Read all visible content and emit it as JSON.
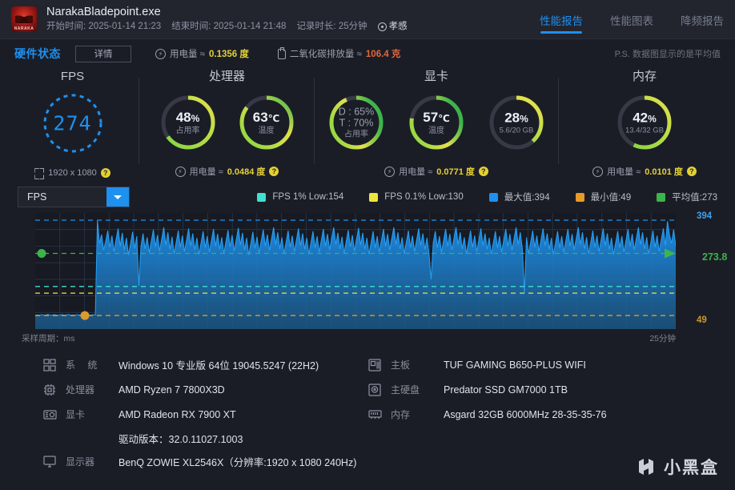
{
  "header": {
    "app_icon_label": "NARAKA",
    "title": "NarakaBladepoint.exe",
    "start_label": "开始时间:",
    "start_time": "2025-01-14 21:23",
    "end_label": "结束时间:",
    "end_time": "2025-01-14 21:48",
    "duration_label": "记录时长:",
    "duration": "25分钟",
    "location": "孝感",
    "tabs": [
      {
        "label": "性能报告",
        "active": true
      },
      {
        "label": "性能图表",
        "active": false
      },
      {
        "label": "降频报告",
        "active": false
      }
    ]
  },
  "statusbar": {
    "section_title": "硬件状态",
    "detail_button": "详情",
    "power_label": "用电量 ≈",
    "power_value": "0.1356 度",
    "co2_label": "二氧化碳排放量 ≈",
    "co2_value": "106.4 克",
    "note": "P.S. 数据图显示的是平均值"
  },
  "gauges": {
    "fps": {
      "title": "FPS",
      "value": "274",
      "resolution": "1920 x 1080",
      "help": "?"
    },
    "cpu": {
      "title": "处理器",
      "items": [
        {
          "main": "48",
          "unit": "%",
          "sub": "占用率",
          "pct": 48
        },
        {
          "main": "63",
          "unit": "℃",
          "sub": "温度",
          "pct": 63
        }
      ],
      "power_label": "用电量 ≈",
      "power_value": "0.0484 度",
      "help": "?"
    },
    "gpu": {
      "title": "显卡",
      "items": [
        {
          "main": "D : 65%",
          "line2": "T : 70%",
          "sub": "占用率",
          "pct": 70,
          "dim": true
        },
        {
          "main": "57",
          "unit": "℃",
          "sub": "温度",
          "pct": 57
        },
        {
          "main": "28",
          "unit": "%",
          "sub": "5.6/20 GB",
          "pct": 28
        }
      ],
      "power_label": "用电量 ≈",
      "power_value": "0.0771 度",
      "help": "?"
    },
    "mem": {
      "title": "内存",
      "items": [
        {
          "main": "42",
          "unit": "%",
          "sub": "13.4/32 GB",
          "pct": 42
        }
      ],
      "power_label": "用电量 ≈",
      "power_value": "0.0101 度",
      "help": "?"
    }
  },
  "chart_toolbar": {
    "metric_selected": "FPS",
    "legend": [
      {
        "label": "FPS 1% Low:154",
        "color": "#3fe0d0"
      },
      {
        "label": "FPS 0.1% Low:130",
        "color": "#efe63c"
      },
      {
        "label": "最大值:394",
        "color": "#1e90ee"
      },
      {
        "label": "最小值:49",
        "color": "#e79b28"
      },
      {
        "label": "平均值:273",
        "color": "#3cb44a"
      }
    ]
  },
  "chart_data": {
    "type": "area",
    "title": "FPS",
    "xlabel": "采样周期：ms",
    "ylabel": "",
    "x_end_label": "25分钟",
    "ylim": [
      0,
      420
    ],
    "grid": true,
    "legend_position": "top-right",
    "reference_lines": [
      {
        "name": "最大值",
        "value": 394,
        "color": "#1e90ee",
        "right_label": "394"
      },
      {
        "name": "平均值",
        "value": 273.8,
        "color": "#3cb44a",
        "right_label": "273.8"
      },
      {
        "name": "FPS 1% Low",
        "value": 154,
        "color": "#3fe0d0",
        "right_label": ""
      },
      {
        "name": "FPS 0.1% Low",
        "value": 130,
        "color": "#efe63c",
        "right_label": ""
      },
      {
        "name": "最小值",
        "value": 49,
        "color": "#e79b28",
        "right_label": "49"
      }
    ],
    "series": [
      {
        "name": "FPS",
        "color": "#1e90ee",
        "values": [
          50,
          51,
          50,
          52,
          51,
          50,
          53,
          51,
          50,
          52,
          51,
          50,
          51,
          52,
          50,
          51,
          53,
          50,
          51,
          50,
          52,
          51,
          50,
          51,
          52,
          50,
          51,
          50,
          52,
          51,
          394,
          310,
          342,
          286,
          318,
          356,
          296,
          338,
          280,
          324,
          364,
          300,
          348,
          286,
          330,
          268,
          310,
          352,
          292,
          336,
          155,
          300,
          346,
          290,
          332,
          276,
          318,
          360,
          298,
          340,
          282,
          326,
          368,
          304,
          350,
          288,
          334,
          272,
          314,
          356,
          296,
          338,
          280,
          322,
          364,
          302,
          346,
          286,
          330,
          270,
          312,
          354,
          294,
          336,
          278,
          320,
          362,
          300,
          344,
          288,
          332,
          274,
          316,
          358,
          298,
          340,
          282,
          324,
          366,
          304,
          348,
          286,
          330,
          268,
          310,
          352,
          292,
          334,
          276,
          318,
          360,
          300,
          342,
          284,
          326,
          368,
          306,
          350,
          290,
          332,
          272,
          314,
          356,
          296,
          338,
          280,
          322,
          364,
          302,
          346,
          288,
          330,
          270,
          312,
          354,
          294,
          336,
          278,
          320,
          362,
          300,
          344,
          286,
          328,
          368,
          306,
          348,
          290,
          334,
          274,
          316,
          358,
          298,
          340,
          282,
          324,
          366,
          304,
          348,
          288,
          330,
          270,
          312,
          354,
          294,
          336,
          278,
          320,
          362,
          300,
          344,
          286,
          328,
          368,
          306,
          350,
          290,
          332,
          272,
          314,
          356,
          296,
          338,
          280,
          322,
          364,
          302,
          346,
          288,
          330,
          270,
          180,
          312,
          354,
          294,
          336,
          278,
          320,
          362,
          300,
          344,
          286,
          328,
          368,
          306,
          350,
          290,
          332,
          272,
          314,
          356,
          296,
          338,
          280,
          322,
          364,
          302,
          346,
          288,
          330,
          270,
          312,
          354,
          294,
          336,
          278,
          320,
          362,
          300,
          344,
          286,
          328,
          368,
          306,
          350,
          290,
          130,
          332,
          272,
          314,
          356,
          296,
          338,
          280,
          322,
          364,
          302,
          346,
          288,
          330,
          270,
          312,
          354,
          294,
          336,
          278,
          320,
          362,
          300,
          344,
          286,
          328,
          368,
          306,
          350,
          290,
          332,
          272,
          314,
          356,
          296,
          338,
          280,
          322,
          364,
          302,
          346,
          288,
          330,
          270,
          312,
          354,
          294,
          336,
          278,
          320,
          362,
          300,
          344,
          286,
          328,
          368,
          306,
          350,
          290,
          332,
          272,
          314,
          356,
          296,
          338,
          280,
          322,
          364,
          302,
          390,
          340,
          310,
          360,
          300
        ]
      }
    ],
    "markers": [
      {
        "name": "average-dot",
        "value": 273.8,
        "color": "#3cb44a",
        "position": "left"
      },
      {
        "name": "minimum-dot",
        "value": 49,
        "color": "#e79b28",
        "position": "left"
      }
    ]
  },
  "specs": {
    "left": [
      {
        "icon": "system-icon",
        "label": "系  统",
        "value": "Windows 10 专业版 64位 19045.5247 (22H2)"
      },
      {
        "icon": "cpu-icon",
        "label": "处理器",
        "value": "AMD Ryzen 7 7800X3D"
      },
      {
        "icon": "gpu-icon",
        "label": "显卡",
        "value": "AMD Radeon RX 7900 XT",
        "sub": "驱动版本：32.0.11027.1003"
      },
      {
        "icon": "monitor-icon",
        "label": "显示器",
        "value": "BenQ ZOWIE XL2546X（分辨率:1920 x 1080 240Hz)"
      }
    ],
    "right": [
      {
        "icon": "motherboard-icon",
        "label": "主板",
        "value": "TUF GAMING B650-PLUS WIFI"
      },
      {
        "icon": "disk-icon",
        "label": "主硬盘",
        "value": "Predator SSD GM7000 1TB"
      },
      {
        "icon": "ram-icon",
        "label": "内存",
        "value": "Asgard 32GB 6000MHz 28-35-35-76"
      }
    ]
  },
  "watermark": {
    "text": "小黑盒"
  }
}
